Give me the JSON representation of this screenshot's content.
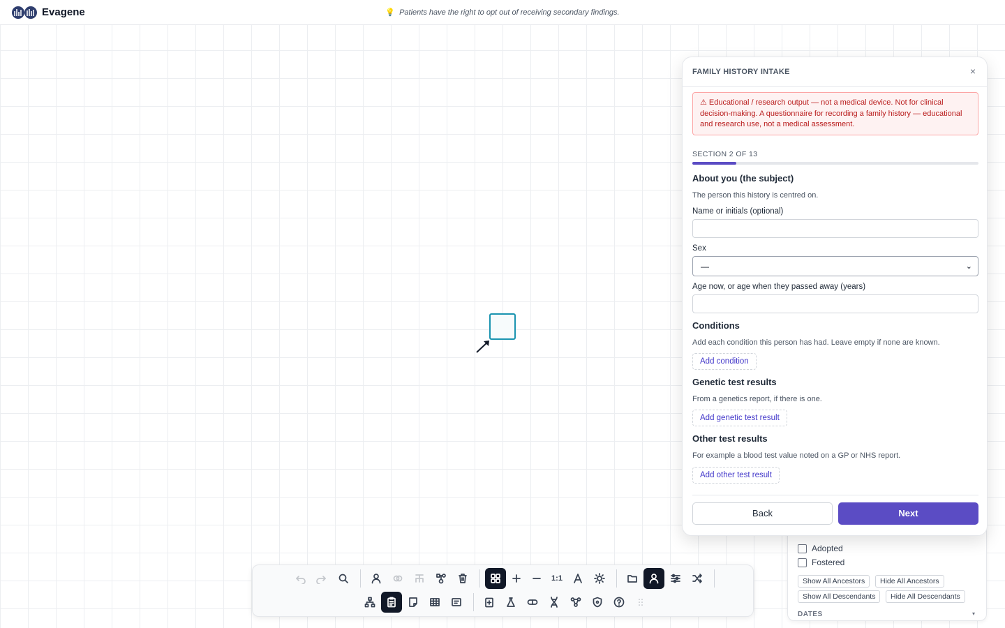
{
  "app": {
    "name": "Evagene"
  },
  "header": {
    "tip": "Patients have the right to opt out of receiving secondary findings."
  },
  "modal": {
    "title": "FAMILY HISTORY INTAKE",
    "close": "×",
    "warning": "⚠ Educational / research output — not a medical device. Not for clinical decision-making. A questionnaire for recording a family history — educational and research use, not a medical assessment.",
    "section_label": "SECTION 2 OF 13",
    "progress": {
      "current": 2,
      "total": 13
    },
    "about": {
      "heading": "About you (the subject)",
      "description": "The person this history is centred on.",
      "name_label": "Name or initials (optional)",
      "name_value": "",
      "sex_label": "Sex",
      "sex_value": "—",
      "age_label": "Age now, or age when they passed away (years)",
      "age_value": ""
    },
    "conditions": {
      "heading": "Conditions",
      "description": "Add each condition this person has had. Leave empty if none are known.",
      "add_button": "Add condition"
    },
    "genetic": {
      "heading": "Genetic test results",
      "description": "From a genetics report, if there is one.",
      "add_button": "Add genetic test result"
    },
    "other": {
      "heading": "Other test results",
      "description": "For example a blood test value noted on a GP or NHS report.",
      "add_button": "Add other test result"
    },
    "back_button": "Back",
    "next_button": "Next"
  },
  "side_panel": {
    "checkboxes": [
      {
        "label": "Adopted",
        "checked": false
      },
      {
        "label": "Fostered",
        "checked": false
      }
    ],
    "buttons": [
      "Show All Ancestors",
      "Hide All Ancestors",
      "Show All Descendants",
      "Hide All Descendants"
    ],
    "dates_label": "DATES",
    "dates_caret": "▾"
  },
  "toolbar": {
    "zoom_reset": "1:1",
    "active_tools": [
      "grid-icon",
      "intake-icon",
      "person-panel-icon"
    ],
    "icons_row1": [
      "undo-icon",
      "redo-icon",
      "search-icon",
      "add-person-icon",
      "link-icon",
      "add-children-icon",
      "family-icon",
      "delete-icon",
      "grid-icon",
      "zoom-in-icon",
      "zoom-out-icon",
      "zoom-reset",
      "font-icon",
      "theme-icon",
      "open-file-icon",
      "person-panel-icon",
      "settings-icon",
      "shuffle-icon"
    ],
    "icons_row2": [
      "tree-layout-icon",
      "intake-icon",
      "notes-icon",
      "table-icon",
      "form-icon",
      "clipboard-icon",
      "lab-icon",
      "pill-icon",
      "dna-icon",
      "network-icon",
      "shield-icon",
      "help-icon",
      "drag-handle-icon"
    ]
  }
}
